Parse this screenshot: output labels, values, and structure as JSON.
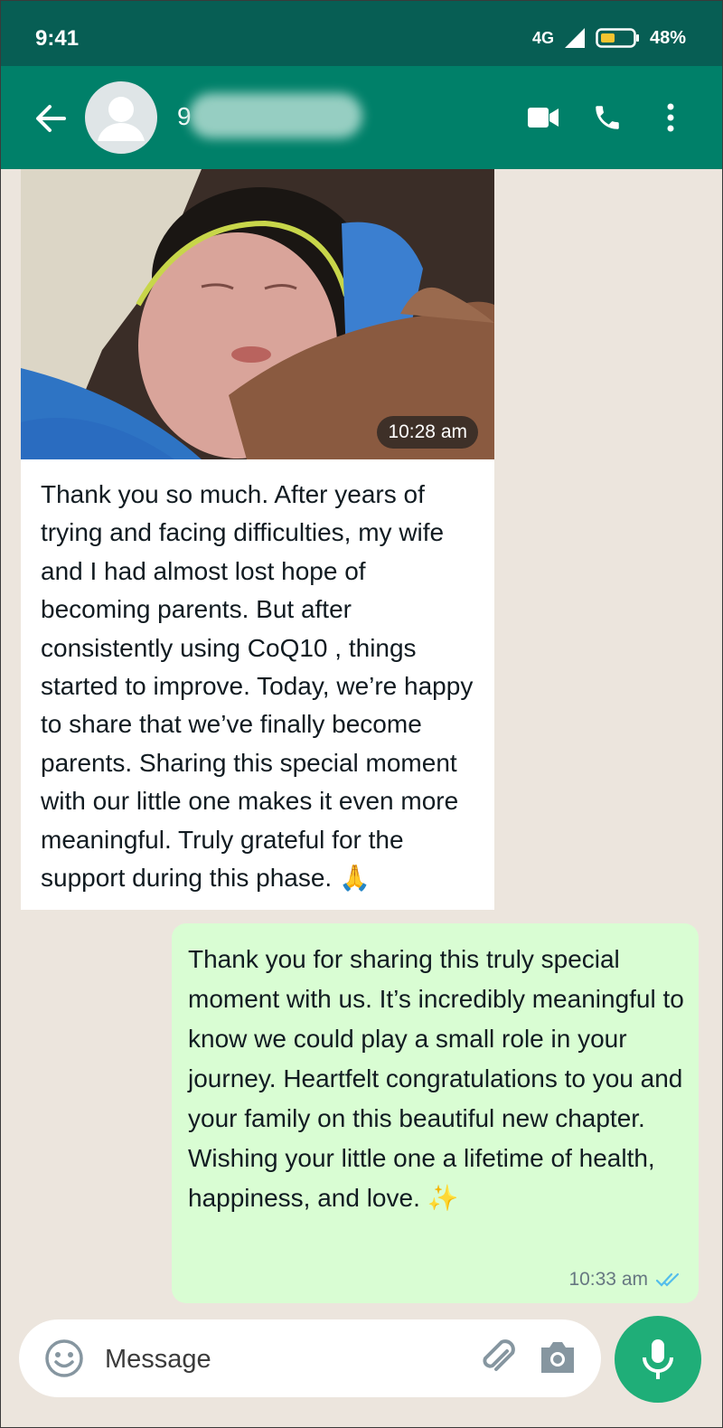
{
  "status_bar": {
    "time": "9:41",
    "network": "4G",
    "battery": "48%"
  },
  "header": {
    "contact_name_visible": "9"
  },
  "messages": {
    "incoming": {
      "image_time": "10:28 am",
      "text": "Thank you so much. After years of trying and facing difficulties, my wife and I had almost lost hope of becoming parents. But after consistently using CoQ10 , things started to improve. Today, we’re happy to share that we’ve finally become parents. Sharing this special moment with our little one makes it even more meaningful. Truly grateful for the support during this phase. 🙏"
    },
    "outgoing": {
      "text": "Thank you for sharing this truly special moment with us. It’s incredibly meaningful to know we could play a small role in your journey. Heartfelt congratulations to you and your family on this beautiful new chapter. Wishing your little one a lifetime of health, happiness, and love. ✨",
      "time": "10:33 am"
    }
  },
  "composer": {
    "placeholder": "Message"
  },
  "colors": {
    "status_bar": "#075e54",
    "app_bar": "#008069",
    "outgoing_bubble": "#d9fdd3",
    "mic_button": "#1fae78",
    "read_ticks": "#53bdeb"
  }
}
